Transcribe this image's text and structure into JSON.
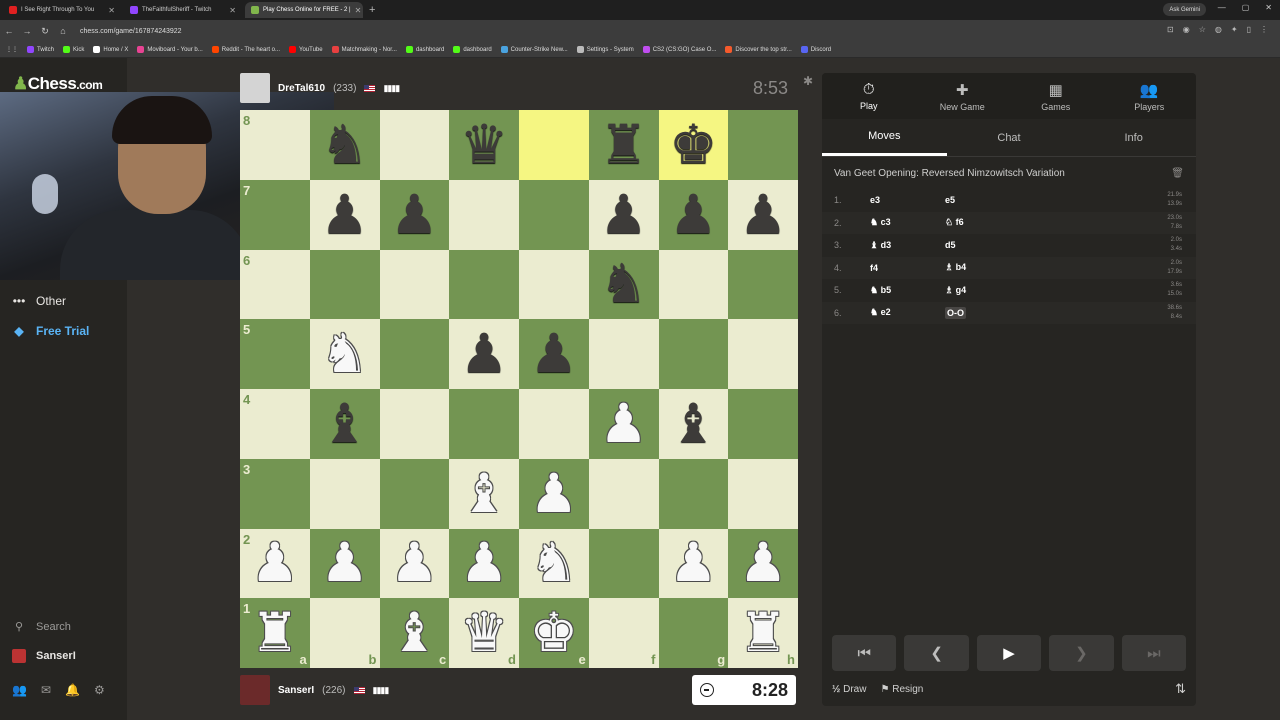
{
  "browser": {
    "tabs": [
      {
        "title": "I See Right Through To You",
        "fav": "#e02020",
        "active": false
      },
      {
        "title": "TheFaithfulSheriff - Twitch",
        "fav": "#9146ff",
        "active": false
      },
      {
        "title": "Play Chess Online for FREE - 2 |",
        "fav": "#81b64c",
        "active": true
      }
    ],
    "gemini": "Ask Gemini",
    "url": "chess.com/game/167874243922",
    "bookmarks": [
      {
        "label": "Twitch",
        "color": "#9146ff"
      },
      {
        "label": "Kick",
        "color": "#53fc18"
      },
      {
        "label": "Home / X",
        "color": "#ffffff"
      },
      {
        "label": "Moviboard - Your b...",
        "color": "#e84393"
      },
      {
        "label": "Reddit - The heart o...",
        "color": "#ff4500"
      },
      {
        "label": "YouTube",
        "color": "#ff0000"
      },
      {
        "label": "Matchmaking - Nor...",
        "color": "#e84040"
      },
      {
        "label": "dashboard",
        "color": "#53fc18"
      },
      {
        "label": "dashboard",
        "color": "#53fc18"
      },
      {
        "label": "Counter-Strike New...",
        "color": "#4aa3df"
      },
      {
        "label": "Settings - System",
        "color": "#bbbbbb"
      },
      {
        "label": "CS2 (CS:GO) Case O...",
        "color": "#c04ef0"
      },
      {
        "label": "Discover the top str...",
        "color": "#f55a2c"
      },
      {
        "label": "Discord",
        "color": "#5865f2"
      }
    ]
  },
  "sidebar": {
    "logo_prefix": "Chess",
    "logo_suffix": ".com",
    "other": "Other",
    "free_trial": "Free Trial",
    "search": "Search",
    "user": "SanserI"
  },
  "top_player": {
    "name": "DreTal610",
    "rating": "(233)",
    "clock": "8:53"
  },
  "bottom_player": {
    "name": "SanserI",
    "rating": "(226)",
    "clock": "8:28"
  },
  "board": {
    "ranks": [
      "8",
      "7",
      "6",
      "5",
      "4",
      "3",
      "2",
      "1"
    ],
    "files": [
      "a",
      "b",
      "c",
      "d",
      "e",
      "f",
      "g",
      "h"
    ],
    "position": [
      [
        "",
        "bn",
        "",
        "bq",
        "",
        "br",
        "bk",
        ""
      ],
      [
        "",
        "bp",
        "bp",
        "",
        "",
        "bp",
        "bp",
        "bp"
      ],
      [
        "",
        "",
        "",
        "",
        "",
        "bn",
        "",
        ""
      ],
      [
        "",
        "wn",
        "",
        "bp",
        "bp",
        "",
        "",
        ""
      ],
      [
        "",
        "bb",
        "",
        "",
        "",
        "wp",
        "bb",
        ""
      ],
      [
        "",
        "",
        "",
        "wb",
        "wp",
        "",
        "",
        ""
      ],
      [
        "wp",
        "wp",
        "wp",
        "wp",
        "wn",
        "",
        "wp",
        "wp"
      ],
      [
        "wr",
        "",
        "wb",
        "wq",
        "wk",
        "",
        "",
        "wr"
      ]
    ],
    "highlight": [
      "e8",
      "g8"
    ]
  },
  "panel": {
    "tabs": [
      {
        "label": "Play",
        "icon": "stopwatch-icon",
        "glyph": "⏱"
      },
      {
        "label": "New Game",
        "icon": "plus-icon",
        "glyph": "✚"
      },
      {
        "label": "Games",
        "icon": "grid-icon",
        "glyph": "▦"
      },
      {
        "label": "Players",
        "icon": "people-icon",
        "glyph": "👥"
      }
    ],
    "subtabs": [
      "Moves",
      "Chat",
      "Info"
    ],
    "opening": "Van Geet Opening: Reversed Nimzowitsch Variation",
    "moves": [
      {
        "num": "1.",
        "white": "e3",
        "black": "e5",
        "wt": "21.9s",
        "bt": "13.9s"
      },
      {
        "num": "2.",
        "white": "♞ c3",
        "black": "♘ f6",
        "wt": "23.0s",
        "bt": "7.8s"
      },
      {
        "num": "3.",
        "white": "♝ d3",
        "black": "d5",
        "wt": "2.0s",
        "bt": "3.4s"
      },
      {
        "num": "4.",
        "white": "f4",
        "black": "♗ b4",
        "wt": "2.0s",
        "bt": "17.9s"
      },
      {
        "num": "5.",
        "white": "♞ b5",
        "black": "♗ g4",
        "wt": "3.6s",
        "bt": "15.0s"
      },
      {
        "num": "6.",
        "white": "♞ e2",
        "black": "O-O",
        "wt": "38.6s",
        "bt": "8.4s"
      }
    ],
    "draw": "Draw",
    "resign": "Resign"
  }
}
